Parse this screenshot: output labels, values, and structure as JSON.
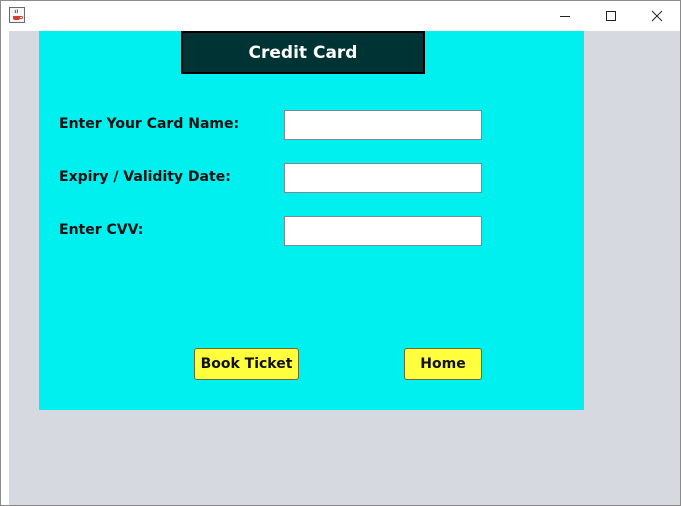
{
  "window": {
    "icons": {
      "app": "java-cup-icon",
      "minimize": "minimize-icon",
      "maximize": "maximize-icon",
      "close": "close-icon"
    }
  },
  "header": {
    "title": "Credit Card"
  },
  "form": {
    "card_name_label": "Enter Your Card Name:",
    "card_name_value": "",
    "expiry_label": "Expiry / Validity Date:",
    "expiry_value": "",
    "cvv_label": "Enter CVV:",
    "cvv_value": ""
  },
  "actions": {
    "book_label": "Book Ticket",
    "home_label": "Home"
  },
  "colors": {
    "panel": "#00efef",
    "header": "#003333",
    "button": "#ffff3d",
    "client": "#d6d9e0"
  }
}
